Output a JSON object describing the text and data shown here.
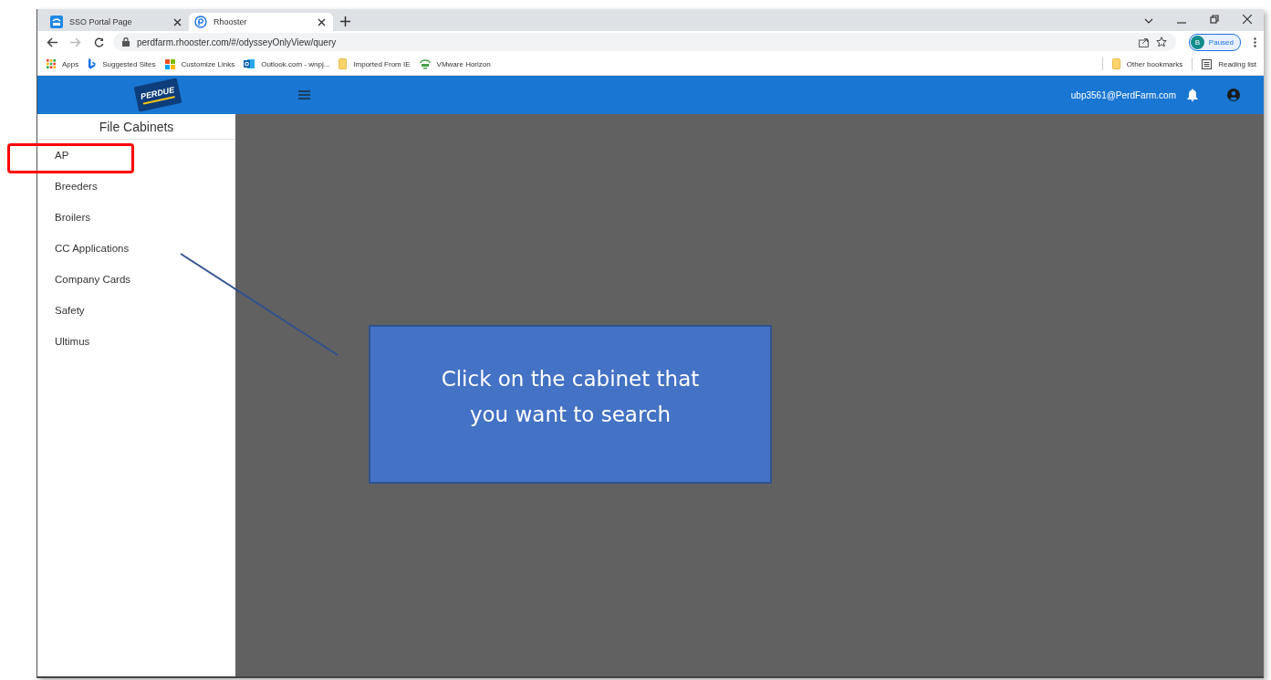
{
  "browser": {
    "tabs": [
      {
        "title": "SSO Portal Page",
        "selected": false,
        "kind": "sso"
      },
      {
        "title": "Rhooster",
        "selected": true,
        "kind": "rhooster"
      }
    ],
    "url": "perdfarm.rhooster.com/#/odysseyOnlyView/query",
    "profile": {
      "initial": "B",
      "status": "Paused"
    },
    "bookmarks": [
      {
        "label": "Apps",
        "kind": "apps"
      },
      {
        "label": "Suggested Sites",
        "kind": "bing"
      },
      {
        "label": "Customize Links",
        "kind": "windows"
      },
      {
        "label": "Outlook.com - wnpj...",
        "kind": "outlook"
      },
      {
        "label": "Imported From IE",
        "kind": "folder"
      },
      {
        "label": "VMware Horizon",
        "kind": "vmware"
      }
    ],
    "bookmarks_right": [
      {
        "label": "Other bookmarks",
        "kind": "folder"
      },
      {
        "label": "Reading list",
        "kind": "reading"
      }
    ]
  },
  "app": {
    "logo": "PERDUE",
    "user": "ubp3561@PerdFarm.com",
    "sidebar": {
      "title": "File Cabinets",
      "items": [
        {
          "label": "AP",
          "highlighted": true
        },
        {
          "label": "Breeders",
          "highlighted": false
        },
        {
          "label": "Broilers",
          "highlighted": false
        },
        {
          "label": "CC Applications",
          "highlighted": false
        },
        {
          "label": "Company Cards",
          "highlighted": false
        },
        {
          "label": "Safety",
          "highlighted": false
        },
        {
          "label": "Ultimus",
          "highlighted": false
        }
      ]
    }
  },
  "callout": {
    "text": "Click on the cabinet that you want to search"
  }
}
